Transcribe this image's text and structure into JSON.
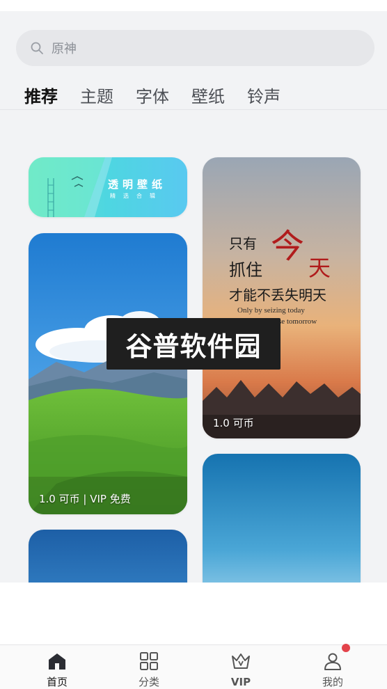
{
  "search": {
    "placeholder": "原神"
  },
  "tabs": [
    {
      "label": "推荐",
      "active": true
    },
    {
      "label": "主题"
    },
    {
      "label": "字体"
    },
    {
      "label": "壁纸"
    },
    {
      "label": "铃声"
    }
  ],
  "banner": {
    "title": "透明壁纸",
    "subtitle": "精选合辑"
  },
  "cards": [
    {
      "price": "1.0 可币 | VIP 免费",
      "image": "mountain-meadow-wallpaper"
    },
    {
      "price": "1.0 可币",
      "image": "sunset-quote-wallpaper",
      "quote": {
        "line1": "只有",
        "line2": "抓住",
        "big1": "今",
        "big2": "天",
        "line3": "才能不丢失明天",
        "english1": "Only by seizing today",
        "english2": "can we not lose tomorrow"
      }
    },
    {
      "image": "blue-sky-wallpaper"
    },
    {
      "image": "blue-gradient-wallpaper"
    }
  ],
  "watermark": {
    "text": "谷普软件园"
  },
  "nav": [
    {
      "label": "首页",
      "icon": "home-icon",
      "active": true
    },
    {
      "label": "分类",
      "icon": "grid-icon"
    },
    {
      "label": "VIP",
      "icon": "crown-icon"
    },
    {
      "label": "我的",
      "icon": "user-icon",
      "badge": true
    }
  ],
  "colors": {
    "background": "#f2f3f5",
    "badge": "#e3434b",
    "active_text": "#111111"
  }
}
